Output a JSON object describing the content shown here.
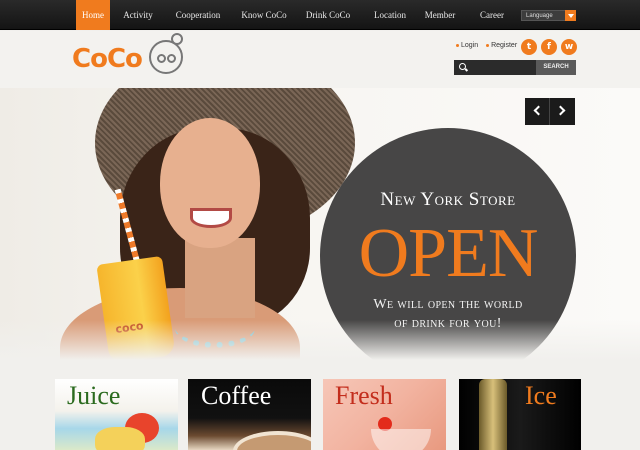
{
  "nav": {
    "items": [
      {
        "label": "Home",
        "active": true
      },
      {
        "label": "Activity"
      },
      {
        "label": "Cooperation"
      },
      {
        "label": "Know CoCo"
      },
      {
        "label": "Drink CoCo"
      },
      {
        "label": "Location"
      },
      {
        "label": "Member"
      },
      {
        "label": "Career"
      }
    ],
    "language_label": "Language"
  },
  "header": {
    "logo_text": "CoCo",
    "login_label": "Login",
    "register_label": "Register",
    "search_placeholder": "",
    "search_button": "SEARCH",
    "social_icons": [
      "twitter-icon",
      "facebook-icon",
      "weibo-icon"
    ]
  },
  "hero": {
    "line1": "New York Store",
    "line2": "OPEN",
    "line3a": "We will open the world",
    "line3b": "of drink for you!",
    "cup_logo": "coco"
  },
  "tiles": [
    {
      "title": "Juice"
    },
    {
      "title": "Coffee"
    },
    {
      "title": "Fresh"
    },
    {
      "title": "Ice"
    }
  ],
  "colors": {
    "accent": "#f07b1e",
    "nav_bg": "#1c1c1c",
    "hero_circle": "#474646"
  }
}
